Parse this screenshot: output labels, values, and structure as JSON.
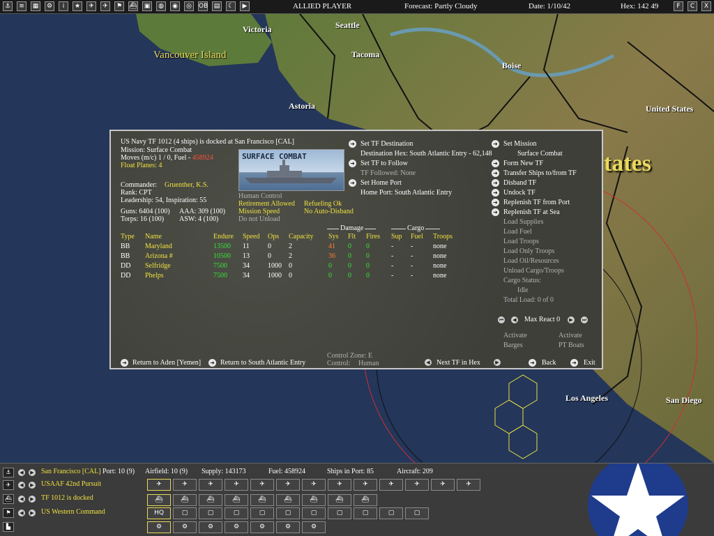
{
  "topbar": {
    "icons": [
      "anchor",
      "list",
      "chart",
      "gear",
      "info",
      "star",
      "plane",
      "plane2",
      "flag",
      "ship",
      "group",
      "globe",
      "earth",
      "target",
      "ob",
      "bars",
      "moon",
      "next"
    ],
    "side": "ALLIED PLAYER",
    "forecast": "Forecast: Partly Cloudy",
    "date": "Date: 1/10/42",
    "hex": "Hex: 142 49",
    "right_icons": [
      "F",
      "C",
      "X"
    ]
  },
  "map": {
    "cities": [
      "Victoria",
      "Seattle",
      "Tacoma",
      "Astoria",
      "Boise",
      "United States",
      "Los Angeles",
      "San Diego"
    ],
    "island": "Vancouver Island",
    "region_label": "tates"
  },
  "panel": {
    "summary": "US Navy TF 1012 (4 ships) is docked at San Francisco [CAL]",
    "mission": "Mission: Surface Combat",
    "moves": "Moves (m/c)  1 / 0, Fuel -",
    "fuel_value": "458924",
    "float_planes": "Float Planes: 4",
    "image_label": "SURFACE COMBAT",
    "commander_label": "Commander:",
    "commander_name": "Gruenther, K.S.",
    "rank": "Rank: CPT",
    "leadership": "Leadership: 54, Inspiration: 55",
    "control": "Human Control",
    "retirement": "Retirement Allowed",
    "refueling": "Refueling Ok",
    "mission_speed": "Mission Speed",
    "no_auto_disband": "No Auto-Disband",
    "do_not_unload": "Do not Unload",
    "guns": "Guns: 6404 (100)",
    "aaa": "AAA: 309 (100)",
    "torps": "Torps: 16 (100)",
    "asw": "ASW: 4 (100)",
    "middle": {
      "set_destination": "Set TF Destination",
      "destination_hex": "Destination Hex: South Atlantic Entry - 62,148",
      "set_follow": "Set TF to Follow",
      "followed": "TF Followed: None",
      "set_home": "Set Home Port",
      "home_port": "Home Port: South Atlantic Entry"
    },
    "right": {
      "set_mission": "Set Mission",
      "mission_value": "Surface Combat",
      "form_new": "Form New TF",
      "transfer": "Transfer Ships to/from TF",
      "disband": "Disband TF",
      "undock": "Undock TF",
      "replenish_port": "Replenish TF from Port",
      "replenish_sea": "Replenish TF at Sea",
      "load_supplies": "Load Supplies",
      "load_fuel": "Load Fuel",
      "load_troops": "Load Troops",
      "load_only_troops": "Load Only Troops",
      "load_oil": "Load Oil/Resources",
      "unload": "Unload Cargo/Troops",
      "cargo_status": "Cargo Status:",
      "cargo_value": "Idle",
      "total_load": "Total Load: 0 of 0",
      "max_react": "Max React 0",
      "activate1a": "Activate",
      "activate1b": "Barges",
      "activate2a": "Activate",
      "activate2b": "PT Boats"
    },
    "group_headers": {
      "damage": "Damage",
      "cargo": "Cargo"
    },
    "columns": [
      "Type",
      "Name",
      "Endure",
      "Speed",
      "Ops",
      "Capacity",
      "Sys",
      "Flt",
      "Fires",
      "Sup",
      "Fuel",
      "Troops"
    ],
    "ships": [
      {
        "type": "BB",
        "name": "Maryland",
        "endure": "13500",
        "speed": "11",
        "ops": "0",
        "capacity": "2",
        "sys": "41",
        "flt": "0",
        "fires": "0",
        "sup": "-",
        "fuel": "-",
        "troops": "none",
        "sys_color": "o"
      },
      {
        "type": "BB",
        "name": "Arizona #",
        "endure": "10500",
        "speed": "13",
        "ops": "0",
        "capacity": "2",
        "sys": "36",
        "flt": "0",
        "fires": "0",
        "sup": "-",
        "fuel": "-",
        "troops": "none",
        "sys_color": "o"
      },
      {
        "type": "DD",
        "name": "Selfridge",
        "endure": "7500",
        "speed": "34",
        "ops": "1000",
        "capacity": "0",
        "sys": "0",
        "flt": "0",
        "fires": "0",
        "sup": "-",
        "fuel": "-",
        "troops": "none",
        "sys_color": "g"
      },
      {
        "type": "DD",
        "name": "Phelps",
        "endure": "7500",
        "speed": "34",
        "ops": "1000",
        "capacity": "0",
        "sys": "0",
        "flt": "0",
        "fires": "0",
        "sup": "-",
        "fuel": "-",
        "troops": "none",
        "sys_color": "g"
      }
    ],
    "footer": {
      "return1": "Return to Aden [Yemen]",
      "return2": "Return to South Atlantic Entry",
      "control_zone": "Control Zone: E",
      "control_label": "Control:",
      "control_value": "Human",
      "next_tf": "Next TF in Hex",
      "back": "Back",
      "exit": "Exit"
    }
  },
  "bottombar": {
    "base": "San Francisco [CAL]",
    "port": "Port: 10 (9)",
    "airfield": "Airfield: 10 (9)",
    "supply": "Supply: 143173",
    "fuel": "Fuel: 458924",
    "ships_in_port": "Ships in Port: 85",
    "aircraft": "Aircraft: 209",
    "air_unit": "USAAF 42nd Pursuit",
    "tf": "TF 1012 is docked",
    "command": "US Western Command",
    "hq_label": "HQ"
  }
}
